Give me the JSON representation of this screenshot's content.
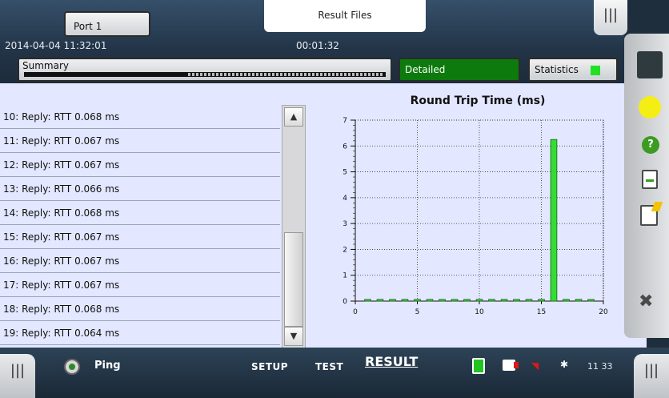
{
  "header": {
    "port_tab": "Port 1",
    "result_files_tab": "Result Files",
    "datetime": "2014-04-04 11:32:01",
    "elapsed": "00:01:32",
    "summary_tab": "Summary",
    "detailed_tab": "Detailed",
    "statistics_tab": "Statistics",
    "handle_glyph": "|||"
  },
  "list": {
    "rows": [
      "10: Reply: RTT 0.068 ms",
      "11: Reply: RTT 0.067 ms",
      "12: Reply: RTT 0.067 ms",
      "13: Reply: RTT 0.066 ms",
      "14: Reply: RTT 0.068 ms",
      "15: Reply: RTT 0.067 ms",
      "16: Reply: RTT 0.067 ms",
      "17: Reply: RTT 0.067 ms",
      "18: Reply: RTT 0.068 ms",
      "19: Reply: RTT 0.064 ms"
    ],
    "scroll_up_glyph": "▲",
    "scroll_down_glyph": "▼"
  },
  "chart_data": {
    "type": "bar",
    "title": "Round Trip Time (ms)",
    "x": [
      1,
      2,
      3,
      4,
      5,
      6,
      7,
      8,
      9,
      10,
      11,
      12,
      13,
      14,
      15,
      16,
      17,
      18,
      19
    ],
    "values": [
      0.066,
      0.067,
      0.066,
      0.067,
      0.066,
      0.067,
      0.066,
      0.066,
      0.067,
      0.068,
      0.067,
      0.067,
      0.066,
      0.068,
      0.067,
      6.25,
      0.067,
      0.068,
      0.064
    ],
    "xlim": [
      0,
      20
    ],
    "ylim": [
      0,
      7
    ],
    "xticks": [
      0,
      5,
      10,
      15,
      20
    ],
    "yticks": [
      0,
      1,
      2,
      3,
      4,
      5,
      6,
      7
    ],
    "grid": true,
    "bar_color": "#33dd33"
  },
  "sidebar": {
    "icons": [
      "panel-icon",
      "status-light-icon",
      "help-icon",
      "report-icon",
      "notes-icon",
      "close-icon"
    ],
    "help_glyph": "?",
    "close_glyph": "✖"
  },
  "bottom_bar": {
    "handle_glyph": "|||",
    "test_name": "Ping",
    "nav": {
      "setup": "SETUP",
      "test": "TEST",
      "result": "RESULT"
    },
    "bluetooth_glyph": "✱",
    "wifi_glyph": "◥",
    "time": "11 33"
  },
  "colors": {
    "header_bg": "#223447",
    "content_bg": "#e3e7ff",
    "detailed_active": "#0c7a0c",
    "status_green": "#22e022",
    "status_yellow": "#f4ee14"
  }
}
